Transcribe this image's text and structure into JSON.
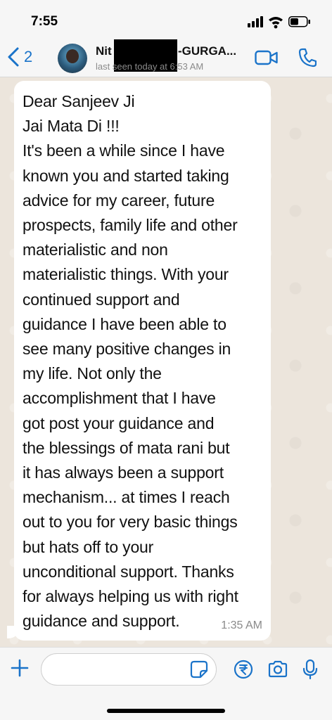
{
  "status_bar": {
    "time": "7:55"
  },
  "header": {
    "back_count": "2",
    "contact_name_start": "Nit",
    "contact_name_end": "-GURGA...",
    "last_seen": "last seen today at 6:53 AM"
  },
  "message": {
    "lines": [
      "Dear Sanjeev Ji",
      "Jai Mata Di !!!",
      "It's been a while since I have",
      "known you and started taking",
      "advice for my career, future",
      "prospects, family life and other",
      "materialistic and non",
      "materialistic things. With your",
      "continued support and",
      "guidance I have been able to",
      "see many positive changes in",
      "my life. Not only the",
      "accomplishment that I have",
      "got post your guidance and",
      "the blessings of mata rani but",
      "it has always been a support",
      "mechanism... at times I reach",
      "out to you for very basic things",
      "but hats off to your",
      "unconditional support. Thanks",
      "for always helping us with right",
      "guidance and support."
    ],
    "time": "1:35 AM"
  },
  "composer": {
    "value": "",
    "placeholder": ""
  },
  "colors": {
    "accent": "#1a73c9",
    "bubble": "#ffffff",
    "chat_background": "#ece5dc",
    "bar_background": "#f6f6f6"
  },
  "icons": {
    "back": "chevron-left-icon",
    "video": "video-camera-icon",
    "call": "phone-icon",
    "attach": "plus-icon",
    "sticker": "sticker-icon",
    "payment": "rupee-icon",
    "camera": "camera-icon",
    "mic": "microphone-icon"
  }
}
